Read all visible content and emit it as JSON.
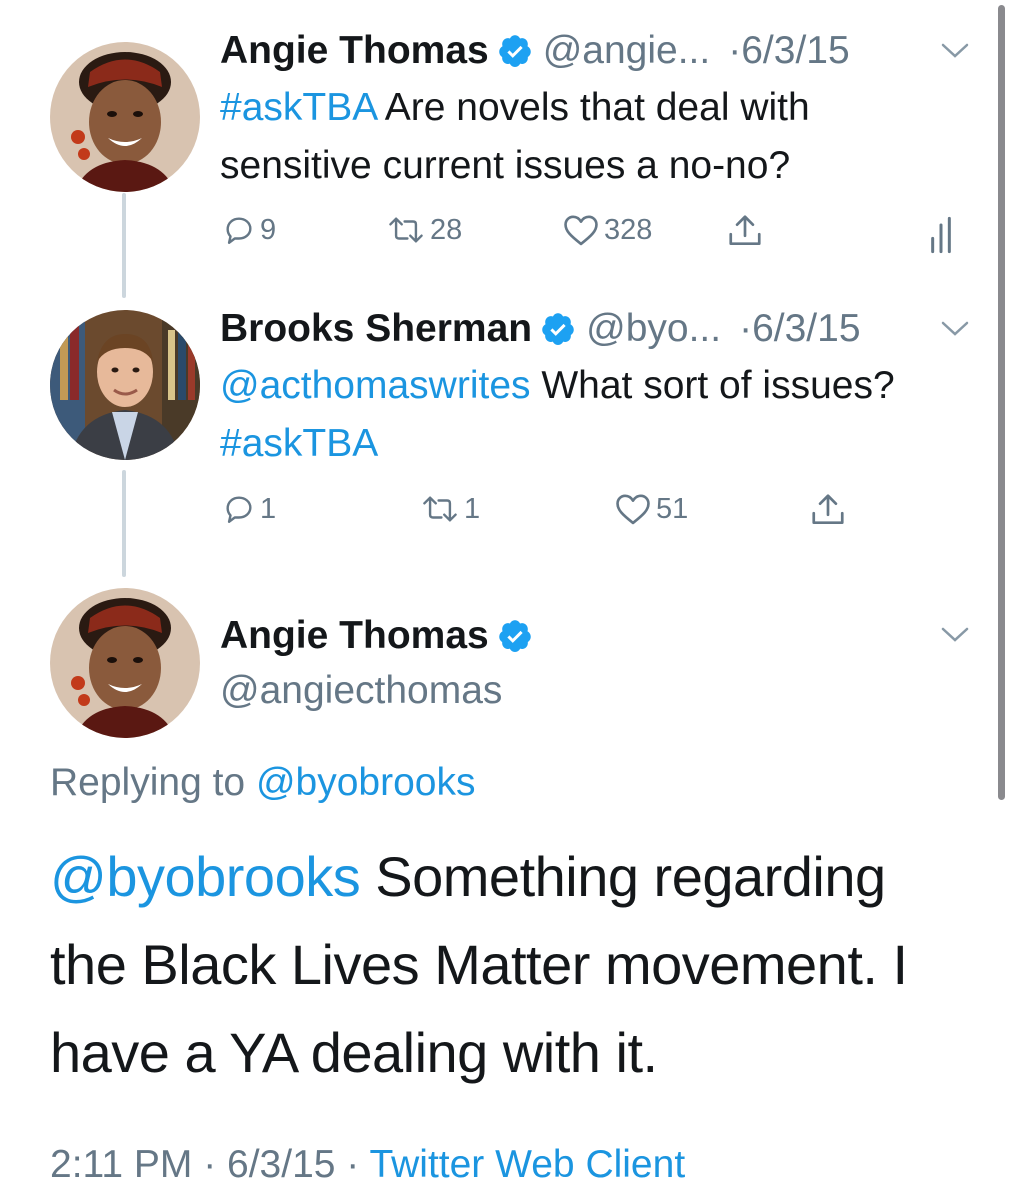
{
  "tweets": [
    {
      "name": "Angie Thomas",
      "handle": "@angie...",
      "dot": "·",
      "date": "6/3/15",
      "hashtag": "#askTBA",
      "text": " Are novels that deal with sensitive current issues a no-no?",
      "replies": "9",
      "retweets": "28",
      "likes": "328"
    },
    {
      "name": "Brooks Sherman",
      "handle": "@byo...",
      "dot": "·",
      "date": "6/3/15",
      "mention": "@acthomaswrites",
      "text": " What sort of issues? ",
      "hashtag": "#askTBA",
      "replies": "1",
      "retweets": "1",
      "likes": "51"
    }
  ],
  "main_tweet": {
    "name": "Angie Thomas",
    "handle": "@angiecthomas",
    "replying_label": "Replying to ",
    "replying_handle": "@byobrooks",
    "mention": "@byobrooks",
    "text": " Something regarding the Black Lives Matter movement. I have a YA dealing with it.",
    "time": "2:11 PM",
    "sep1": " · ",
    "date": "6/3/15",
    "sep2": " · ",
    "source": "Twitter Web Client"
  },
  "colors": {
    "link": "#1b95e0",
    "muted": "#657786",
    "text": "#14171a",
    "verified": "#1da1f2"
  }
}
